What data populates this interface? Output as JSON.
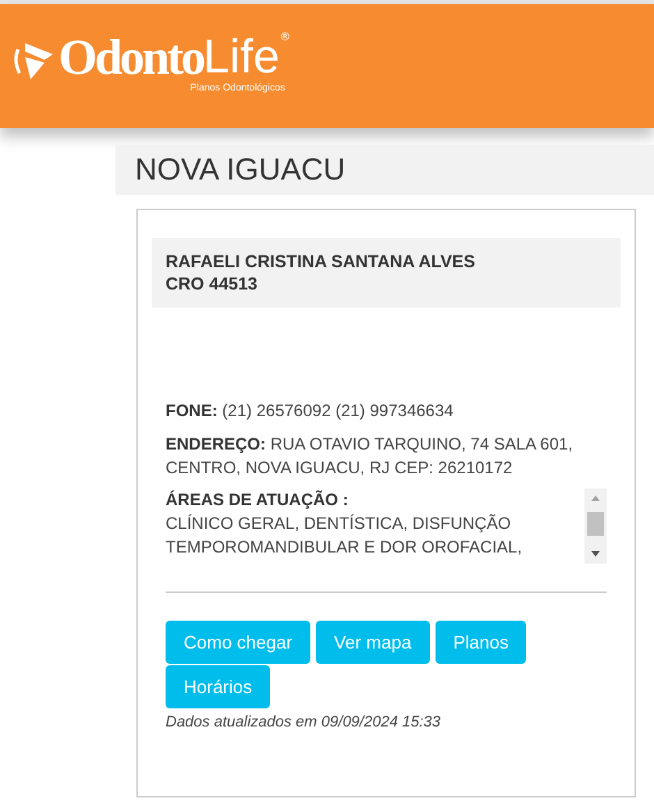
{
  "header": {
    "logo_main": "Odonto",
    "logo_accent": "Life",
    "logo_mark": "®",
    "logo_tagline": "Planos Odontológicos"
  },
  "page_title": "NOVA IGUACU",
  "provider": {
    "name": "RAFAELI CRISTINA SANTANA ALVES",
    "registry": "CRO 44513",
    "phone_label": "FONE:",
    "phone": "(21) 26576092 (21) 997346634",
    "address_label": "ENDEREÇO:",
    "address": "RUA OTAVIO TARQUINO, 74 SALA 601, CENTRO, NOVA IGUACU, RJ CEP: 26210172",
    "areas_label": "ÁREAS DE ATUAÇÃO :",
    "areas": "CLÍNICO GERAL, DENTÍSTICA, DISFUNÇÃO TEMPOROMANDIBULAR E DOR OROFACIAL,"
  },
  "buttons": [
    "Como chegar",
    "Ver mapa",
    "Planos",
    "Horários"
  ],
  "updated": "Dados atualizados em 09/09/2024 15:33"
}
